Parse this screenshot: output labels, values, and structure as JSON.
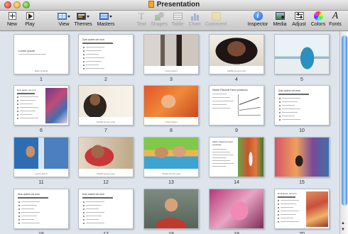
{
  "window": {
    "title": "Presentation"
  },
  "toolbar": {
    "new": "New",
    "play": "Play",
    "view": "View",
    "themes": "Themes",
    "masters": "Masters",
    "text": "Text",
    "shapes": "Shapes",
    "table": "Table",
    "chart": "Chart",
    "comment": "Comment",
    "inspector": "Inspector",
    "media": "Media",
    "adjust": "Adjust",
    "colors": "Colors",
    "fonts": "Fonts"
  },
  "slides": [
    {
      "number": "1",
      "layout": "title",
      "heading": "Lorem ipsum",
      "caption": "Dolor sit amet"
    },
    {
      "number": "2",
      "layout": "bullets",
      "heading": "Duis autem vel eum"
    },
    {
      "number": "3",
      "layout": "photo",
      "photo": "legs",
      "caption": "Lorem ipsum"
    },
    {
      "number": "4",
      "layout": "photo",
      "photo": "portrait",
      "caption": "Facilisi at vero eros"
    },
    {
      "number": "5",
      "layout": "photo",
      "photo": "skyline"
    },
    {
      "number": "6",
      "layout": "bullets-photo",
      "heading": "Duis autem vel eum",
      "photo": "mural"
    },
    {
      "number": "7",
      "layout": "photo",
      "photo": "smiling-man",
      "caption": "Facilisi at vero eros"
    },
    {
      "number": "8",
      "layout": "photo",
      "photo": "girl",
      "caption": "Lorem ipsum"
    },
    {
      "number": "9",
      "layout": "chart",
      "heading": "Mazim Placerat Facer possimus"
    },
    {
      "number": "10",
      "layout": "bullets",
      "heading": "Duis autem vel eum"
    },
    {
      "number": "11",
      "layout": "photo",
      "photo": "man",
      "caption": "Lorem ipsum"
    },
    {
      "number": "12",
      "layout": "photo",
      "photo": "headphones",
      "caption": "Facilisi at vero eros"
    },
    {
      "number": "13",
      "layout": "photo",
      "photo": "kids",
      "caption": "Facilisi at vero eros"
    },
    {
      "number": "14",
      "layout": "text-photo",
      "heading": "Mazim Placerat Facer possimus",
      "photo": "man-standing"
    },
    {
      "number": "15",
      "layout": "photo",
      "photo": "street"
    },
    {
      "number": "16",
      "layout": "bullets",
      "heading": "Duis autem vel eum"
    },
    {
      "number": "17",
      "layout": "bullets",
      "heading": "Duis autem vel eum"
    },
    {
      "number": "18",
      "layout": "photo-top",
      "photo": "woman"
    },
    {
      "number": "19",
      "layout": "photo-top",
      "photo": "mural-pink"
    },
    {
      "number": "20",
      "layout": "bullets-photo",
      "heading": "Duis autem vel eum",
      "photo": "wall"
    }
  ]
}
